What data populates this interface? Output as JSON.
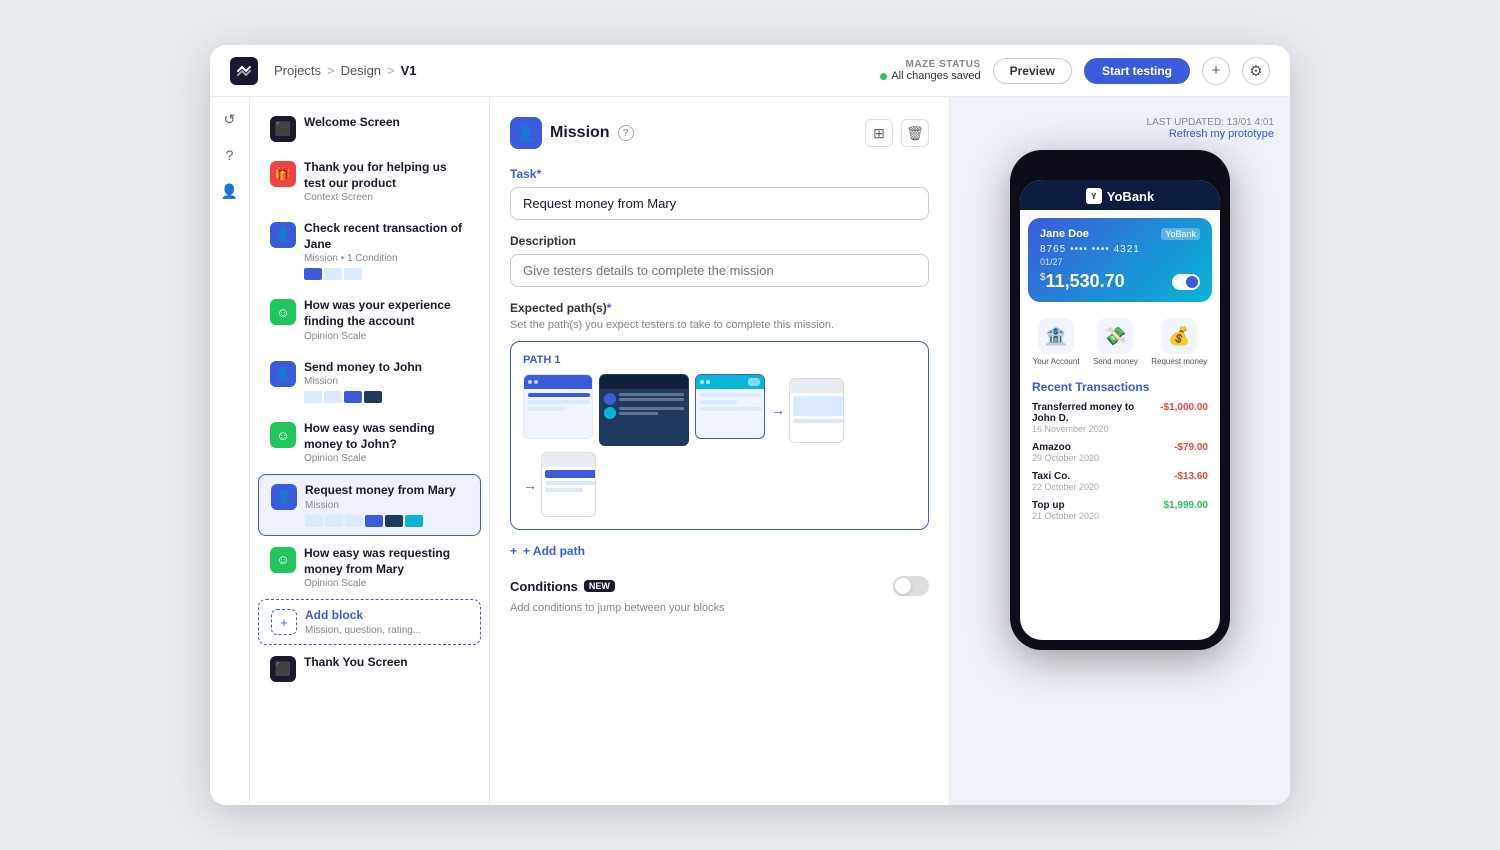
{
  "app": {
    "logo": "M",
    "breadcrumb": {
      "projects": "Projects",
      "sep1": ">",
      "design": "Design",
      "sep2": ">",
      "current": "V1"
    },
    "maze_status": {
      "label": "MAZE STATUS",
      "status": "All changes saved"
    },
    "btn_preview": "Preview",
    "btn_start": "Start testing"
  },
  "sidebar": {
    "items": [
      {
        "id": "welcome",
        "icon_type": "dark",
        "icon": "⬛",
        "title": "Welcome Screen",
        "sub": ""
      },
      {
        "id": "thank_you_helping",
        "icon_type": "red",
        "icon": "🎁",
        "title": "Thank you for helping us test our product",
        "sub": "Context Screen"
      },
      {
        "id": "check_transaction",
        "icon_type": "blue",
        "icon": "👤",
        "title": "Check recent transaction of Jane",
        "sub": "Mission • 1 Condition"
      },
      {
        "id": "experience_finding",
        "icon_type": "green",
        "icon": "😊",
        "title": "How was your experience finding the account",
        "sub": "Opinion Scale"
      },
      {
        "id": "send_money",
        "icon_type": "blue",
        "icon": "👤",
        "title": "Send money to John",
        "sub": "Mission"
      },
      {
        "id": "easy_sending",
        "icon_type": "green",
        "icon": "😊",
        "title": "How easy was sending money to John?",
        "sub": "Opinion Scale"
      },
      {
        "id": "request_money",
        "icon_type": "blue",
        "icon": "👤",
        "title": "Request money from Mary",
        "sub": "Mission",
        "active": true
      },
      {
        "id": "easy_requesting",
        "icon_type": "green",
        "icon": "😊",
        "title": "How easy was requesting money from Mary",
        "sub": "Opinion Scale"
      },
      {
        "id": "add_block",
        "icon_type": "add",
        "icon": "+",
        "title": "Add block",
        "sub": "Mission, question, rating..."
      },
      {
        "id": "thank_you_screen",
        "icon_type": "dark",
        "icon": "⬛",
        "title": "Thank You Screen",
        "sub": ""
      }
    ]
  },
  "editor": {
    "mission_title": "Mission",
    "task_label": "Task",
    "task_required": "*",
    "task_value": "Request money from Mary",
    "description_label": "Description",
    "description_placeholder": "Give testers details to complete the mission",
    "expected_paths_label": "Expected path(s)",
    "expected_paths_required": "*",
    "expected_paths_sub": "Set the path(s) you expect testers to take to complete this mission.",
    "path_label": "PATH 1",
    "add_path_label": "+ Add path",
    "conditions_label": "Conditions",
    "conditions_badge": "NEW",
    "conditions_desc": "Add conditions to jump between your blocks"
  },
  "preview": {
    "last_updated_label": "LAST UPDATED: 13/01 4:01",
    "refresh_label": "Refresh my prototype",
    "phone": {
      "bank_name": "YoBank",
      "card": {
        "name": "Jane Doe",
        "bank_tag": "YoBank",
        "number": "8765 •••• •••• 4321",
        "expiry": "01/27",
        "balance": "11,530.70",
        "currency": "$"
      },
      "quick_actions": [
        {
          "label": "Your Account",
          "emoji": "🏦"
        },
        {
          "label": "Send money",
          "emoji": "💸"
        },
        {
          "label": "Request money",
          "emoji": "💰"
        }
      ],
      "recent_title": "Recent Transactions",
      "transactions": [
        {
          "name": "Transferred money to John D.",
          "date": "16 November 2020",
          "amount": "-$1,000.00",
          "positive": false
        },
        {
          "name": "Amazoo",
          "date": "29 October 2020",
          "amount": "-$79.00",
          "positive": false
        },
        {
          "name": "Taxi Co.",
          "date": "22 October 2020",
          "amount": "-$13.60",
          "positive": false
        },
        {
          "name": "Top up",
          "date": "21 October 2020",
          "amount": "$1,999.00",
          "positive": true
        }
      ]
    }
  }
}
